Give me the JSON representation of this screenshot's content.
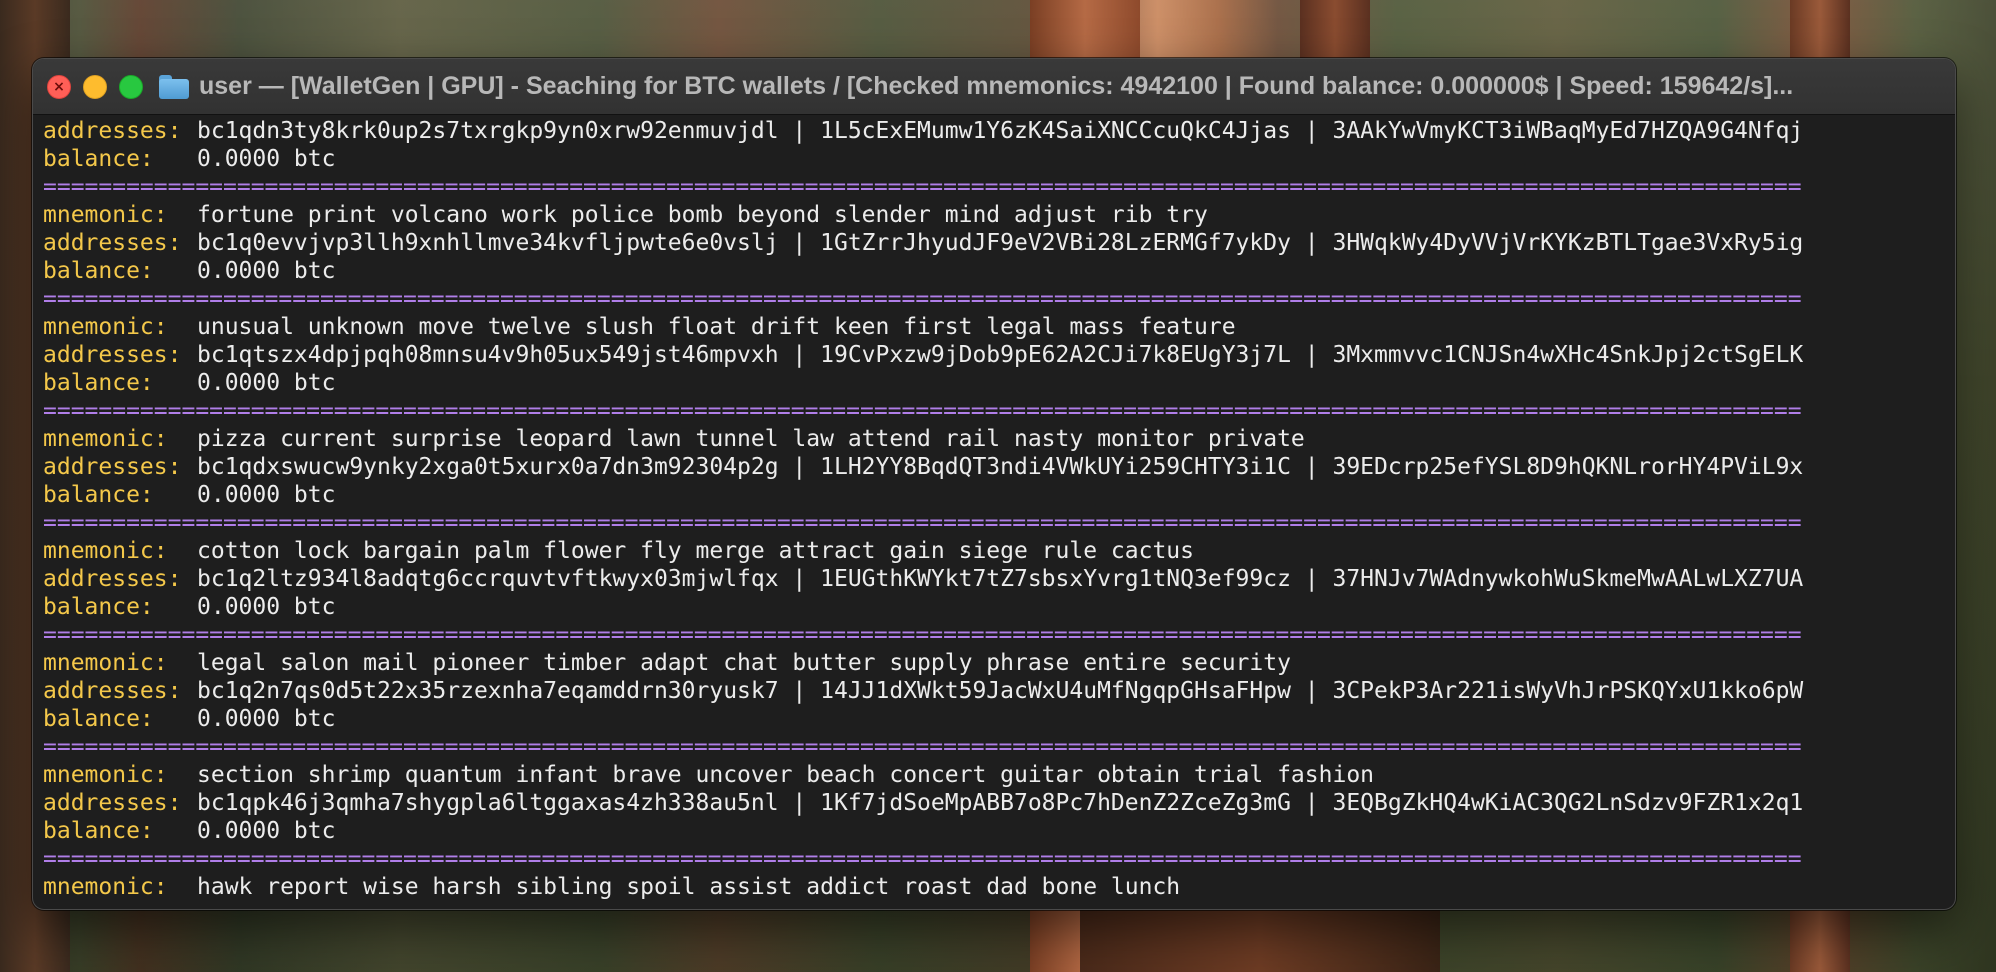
{
  "window": {
    "title": "user — [WalletGen | GPU] - Seaching for BTC wallets / [Checked mnemonics: 4942100 | Found balance: 0.000000$ | Speed: 159642/s]..."
  },
  "labels": {
    "mnemonic": "mnemonic:",
    "addresses": "addresses:",
    "balance": "balance:"
  },
  "separator": "===============================================================================================================================",
  "entries": [
    {
      "addresses": "bc1qdn3ty8krk0up2s7txrgkp9yn0xrw92enmuvjdl | 1L5cExEMumw1Y6zK4SaiXNCCcuQkC4Jjas | 3AAkYwVmyKCT3iWBaqMyEd7HZQA9G4Nfqj",
      "balance": "0.0000 btc"
    },
    {
      "mnemonic": "fortune print volcano work police bomb beyond slender mind adjust rib try",
      "addresses": "bc1q0evvjvp3llh9xnhllmve34kvfljpwte6e0vslj | 1GtZrrJhyudJF9eV2VBi28LzERMGf7ykDy | 3HWqkWy4DyVVjVrKYKzBTLTgae3VxRy5ig",
      "balance": "0.0000 btc"
    },
    {
      "mnemonic": "unusual unknown move twelve slush float drift keen first legal mass feature",
      "addresses": "bc1qtszx4dpjpqh08mnsu4v9h05ux549jst46mpvxh | 19CvPxzw9jDob9pE62A2CJi7k8EUgY3j7L | 3Mxmmvvc1CNJSn4wXHc4SnkJpj2ctSgELK",
      "balance": "0.0000 btc"
    },
    {
      "mnemonic": "pizza current surprise leopard lawn tunnel law attend rail nasty monitor private",
      "addresses": "bc1qdxswucw9ynky2xga0t5xurx0a7dn3m92304p2g | 1LH2YY8BqdQT3ndi4VWkUYi259CHTY3i1C | 39EDcrp25efYSL8D9hQKNLrorHY4PViL9x",
      "balance": "0.0000 btc"
    },
    {
      "mnemonic": "cotton lock bargain palm flower fly merge attract gain siege rule cactus",
      "addresses": "bc1q2ltz934l8adqtg6ccrquvtvftkwyx03mjwlfqx | 1EUGthKWYkt7tZ7sbsxYvrg1tNQ3ef99cz | 37HNJv7WAdnywkohWuSkmeMwAALwLXZ7UA",
      "balance": "0.0000 btc"
    },
    {
      "mnemonic": "legal salon mail pioneer timber adapt chat butter supply phrase entire security",
      "addresses": "bc1q2n7qs0d5t22x35rzexnha7eqamddrn30ryusk7 | 14JJ1dXWkt59JacWxU4uMfNgqpGHsaFHpw | 3CPekP3Ar221isWyVhJrPSKQYxU1kko6pW",
      "balance": "0.0000 btc"
    },
    {
      "mnemonic": "section shrimp quantum infant brave uncover beach concert guitar obtain trial fashion",
      "addresses": "bc1qpk46j3qmha7shygpla6ltggaxas4zh338au5nl | 1Kf7jdSoeMpABB7o8Pc7hDenZ2ZceZg3mG | 3EQBgZkHQ4wKiAC3QG2LnSdzv9FZR1x2q1",
      "balance": "0.0000 btc"
    },
    {
      "mnemonic": "hawk report wise harsh sibling spoil assist addict roast dad bone lunch"
    }
  ]
}
